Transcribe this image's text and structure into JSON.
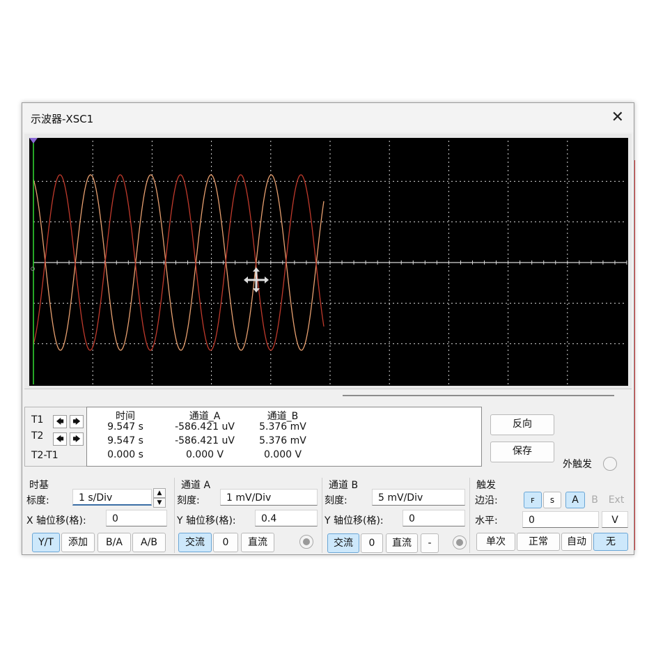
{
  "window": {
    "title": "示波器-XSC1",
    "close_glyph": "✕"
  },
  "colors": {
    "channel_a": "#e8a070",
    "channel_b": "#c03a2c",
    "grid": "#d8d8d8",
    "cursor": "#33dd33",
    "screen_bg": "#000000"
  },
  "cursors": {
    "t1": "T1",
    "t2": "T2",
    "diff": "T2-T1",
    "left_arrow": "🡄",
    "right_arrow": "🡆"
  },
  "measurements": {
    "headers": [
      "时间",
      "通道_A",
      "通道_B"
    ],
    "rows": [
      [
        "9.547 s",
        "-586.421 uV",
        "5.376 mV"
      ],
      [
        "9.547 s",
        "-586.421 uV",
        "5.376 mV"
      ],
      [
        "0.000 s",
        "0.000 V",
        "0.000 V"
      ]
    ]
  },
  "side_buttons": {
    "reverse": "反向",
    "save": "保存",
    "ext_trigger": "外触发"
  },
  "timebase": {
    "title": "时基",
    "scale_label": "标度:",
    "scale_value": "1  s/Div",
    "xpos_label": "X 轴位移(格):",
    "xpos_value": "0",
    "modes": [
      "Y/T",
      "添加",
      "B/A",
      "A/B"
    ]
  },
  "channel_a": {
    "title": "通道 A",
    "scale_label": "刻度:",
    "scale_value": "1 mV/Div",
    "ypos_label": "Y 轴位移(格):",
    "ypos_value": "0.4",
    "coupling": [
      "交流",
      "0",
      "直流"
    ]
  },
  "channel_b": {
    "title": "通道 B",
    "scale_label": "刻度:",
    "scale_value": "5 mV/Div",
    "ypos_label": "Y 轴位移(格):",
    "ypos_value": "0",
    "coupling": [
      "交流",
      "0",
      "直流",
      "-"
    ]
  },
  "trigger": {
    "title": "触发",
    "edge_label": "边沿:",
    "edge_rise": "ꜰ",
    "edge_fall": "ꜱ",
    "sources": [
      "A",
      "B",
      "Ext"
    ],
    "level_label": "水平:",
    "level_value": "0",
    "level_unit": "V",
    "modes": [
      "单次",
      "正常",
      "自动",
      "无"
    ]
  }
}
